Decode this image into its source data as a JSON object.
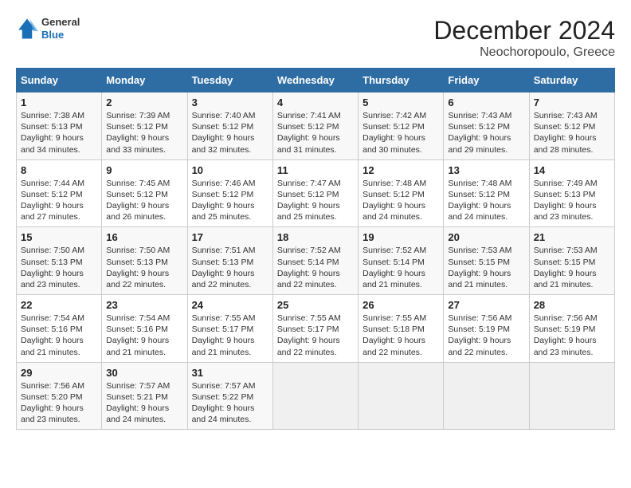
{
  "header": {
    "logo": {
      "line1": "General",
      "line2": "Blue"
    },
    "title": "December 2024",
    "subtitle": "Neochoropoulo, Greece"
  },
  "columns": [
    "Sunday",
    "Monday",
    "Tuesday",
    "Wednesday",
    "Thursday",
    "Friday",
    "Saturday"
  ],
  "weeks": [
    [
      {
        "day": "1",
        "sunrise": "Sunrise: 7:38 AM",
        "sunset": "Sunset: 5:13 PM",
        "daylight": "Daylight: 9 hours and 34 minutes."
      },
      {
        "day": "2",
        "sunrise": "Sunrise: 7:39 AM",
        "sunset": "Sunset: 5:12 PM",
        "daylight": "Daylight: 9 hours and 33 minutes."
      },
      {
        "day": "3",
        "sunrise": "Sunrise: 7:40 AM",
        "sunset": "Sunset: 5:12 PM",
        "daylight": "Daylight: 9 hours and 32 minutes."
      },
      {
        "day": "4",
        "sunrise": "Sunrise: 7:41 AM",
        "sunset": "Sunset: 5:12 PM",
        "daylight": "Daylight: 9 hours and 31 minutes."
      },
      {
        "day": "5",
        "sunrise": "Sunrise: 7:42 AM",
        "sunset": "Sunset: 5:12 PM",
        "daylight": "Daylight: 9 hours and 30 minutes."
      },
      {
        "day": "6",
        "sunrise": "Sunrise: 7:43 AM",
        "sunset": "Sunset: 5:12 PM",
        "daylight": "Daylight: 9 hours and 29 minutes."
      },
      {
        "day": "7",
        "sunrise": "Sunrise: 7:43 AM",
        "sunset": "Sunset: 5:12 PM",
        "daylight": "Daylight: 9 hours and 28 minutes."
      }
    ],
    [
      {
        "day": "8",
        "sunrise": "Sunrise: 7:44 AM",
        "sunset": "Sunset: 5:12 PM",
        "daylight": "Daylight: 9 hours and 27 minutes."
      },
      {
        "day": "9",
        "sunrise": "Sunrise: 7:45 AM",
        "sunset": "Sunset: 5:12 PM",
        "daylight": "Daylight: 9 hours and 26 minutes."
      },
      {
        "day": "10",
        "sunrise": "Sunrise: 7:46 AM",
        "sunset": "Sunset: 5:12 PM",
        "daylight": "Daylight: 9 hours and 25 minutes."
      },
      {
        "day": "11",
        "sunrise": "Sunrise: 7:47 AM",
        "sunset": "Sunset: 5:12 PM",
        "daylight": "Daylight: 9 hours and 25 minutes."
      },
      {
        "day": "12",
        "sunrise": "Sunrise: 7:48 AM",
        "sunset": "Sunset: 5:12 PM",
        "daylight": "Daylight: 9 hours and 24 minutes."
      },
      {
        "day": "13",
        "sunrise": "Sunrise: 7:48 AM",
        "sunset": "Sunset: 5:12 PM",
        "daylight": "Daylight: 9 hours and 24 minutes."
      },
      {
        "day": "14",
        "sunrise": "Sunrise: 7:49 AM",
        "sunset": "Sunset: 5:13 PM",
        "daylight": "Daylight: 9 hours and 23 minutes."
      }
    ],
    [
      {
        "day": "15",
        "sunrise": "Sunrise: 7:50 AM",
        "sunset": "Sunset: 5:13 PM",
        "daylight": "Daylight: 9 hours and 23 minutes."
      },
      {
        "day": "16",
        "sunrise": "Sunrise: 7:50 AM",
        "sunset": "Sunset: 5:13 PM",
        "daylight": "Daylight: 9 hours and 22 minutes."
      },
      {
        "day": "17",
        "sunrise": "Sunrise: 7:51 AM",
        "sunset": "Sunset: 5:13 PM",
        "daylight": "Daylight: 9 hours and 22 minutes."
      },
      {
        "day": "18",
        "sunrise": "Sunrise: 7:52 AM",
        "sunset": "Sunset: 5:14 PM",
        "daylight": "Daylight: 9 hours and 22 minutes."
      },
      {
        "day": "19",
        "sunrise": "Sunrise: 7:52 AM",
        "sunset": "Sunset: 5:14 PM",
        "daylight": "Daylight: 9 hours and 21 minutes."
      },
      {
        "day": "20",
        "sunrise": "Sunrise: 7:53 AM",
        "sunset": "Sunset: 5:15 PM",
        "daylight": "Daylight: 9 hours and 21 minutes."
      },
      {
        "day": "21",
        "sunrise": "Sunrise: 7:53 AM",
        "sunset": "Sunset: 5:15 PM",
        "daylight": "Daylight: 9 hours and 21 minutes."
      }
    ],
    [
      {
        "day": "22",
        "sunrise": "Sunrise: 7:54 AM",
        "sunset": "Sunset: 5:16 PM",
        "daylight": "Daylight: 9 hours and 21 minutes."
      },
      {
        "day": "23",
        "sunrise": "Sunrise: 7:54 AM",
        "sunset": "Sunset: 5:16 PM",
        "daylight": "Daylight: 9 hours and 21 minutes."
      },
      {
        "day": "24",
        "sunrise": "Sunrise: 7:55 AM",
        "sunset": "Sunset: 5:17 PM",
        "daylight": "Daylight: 9 hours and 21 minutes."
      },
      {
        "day": "25",
        "sunrise": "Sunrise: 7:55 AM",
        "sunset": "Sunset: 5:17 PM",
        "daylight": "Daylight: 9 hours and 22 minutes."
      },
      {
        "day": "26",
        "sunrise": "Sunrise: 7:55 AM",
        "sunset": "Sunset: 5:18 PM",
        "daylight": "Daylight: 9 hours and 22 minutes."
      },
      {
        "day": "27",
        "sunrise": "Sunrise: 7:56 AM",
        "sunset": "Sunset: 5:19 PM",
        "daylight": "Daylight: 9 hours and 22 minutes."
      },
      {
        "day": "28",
        "sunrise": "Sunrise: 7:56 AM",
        "sunset": "Sunset: 5:19 PM",
        "daylight": "Daylight: 9 hours and 23 minutes."
      }
    ],
    [
      {
        "day": "29",
        "sunrise": "Sunrise: 7:56 AM",
        "sunset": "Sunset: 5:20 PM",
        "daylight": "Daylight: 9 hours and 23 minutes."
      },
      {
        "day": "30",
        "sunrise": "Sunrise: 7:57 AM",
        "sunset": "Sunset: 5:21 PM",
        "daylight": "Daylight: 9 hours and 24 minutes."
      },
      {
        "day": "31",
        "sunrise": "Sunrise: 7:57 AM",
        "sunset": "Sunset: 5:22 PM",
        "daylight": "Daylight: 9 hours and 24 minutes."
      },
      null,
      null,
      null,
      null
    ]
  ]
}
